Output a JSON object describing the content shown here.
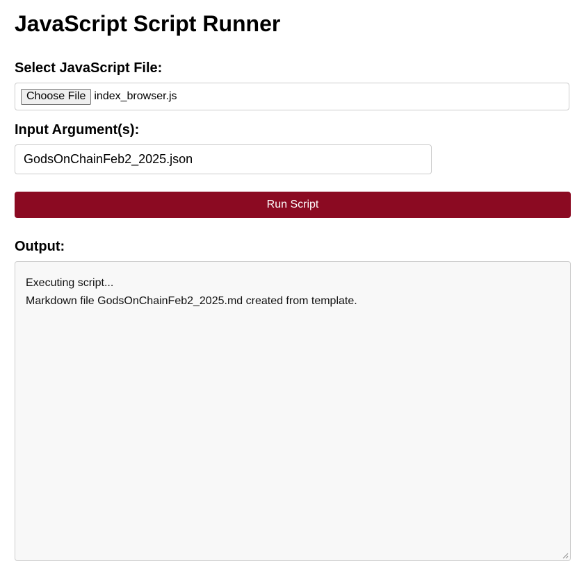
{
  "page": {
    "title": "JavaScript Script Runner"
  },
  "file_select": {
    "label": "Select JavaScript File:",
    "button_label": "Choose File",
    "file_name": "index_browser.js"
  },
  "arguments": {
    "label": "Input Argument(s):",
    "value": "GodsOnChainFeb2_2025.json"
  },
  "run": {
    "button_label": "Run Script",
    "accent_color": "#8b0a22"
  },
  "output": {
    "label": "Output:",
    "lines": [
      "Executing script...",
      "Markdown file GodsOnChainFeb2_2025.md created from template."
    ]
  }
}
